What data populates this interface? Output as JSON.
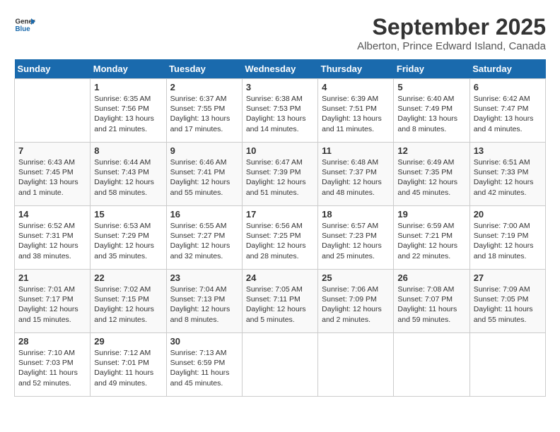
{
  "logo": {
    "line1": "General",
    "line2": "Blue"
  },
  "title": "September 2025",
  "subtitle": "Alberton, Prince Edward Island, Canada",
  "weekdays": [
    "Sunday",
    "Monday",
    "Tuesday",
    "Wednesday",
    "Thursday",
    "Friday",
    "Saturday"
  ],
  "weeks": [
    [
      {
        "day": "",
        "text": ""
      },
      {
        "day": "1",
        "text": "Sunrise: 6:35 AM\nSunset: 7:56 PM\nDaylight: 13 hours\nand 21 minutes."
      },
      {
        "day": "2",
        "text": "Sunrise: 6:37 AM\nSunset: 7:55 PM\nDaylight: 13 hours\nand 17 minutes."
      },
      {
        "day": "3",
        "text": "Sunrise: 6:38 AM\nSunset: 7:53 PM\nDaylight: 13 hours\nand 14 minutes."
      },
      {
        "day": "4",
        "text": "Sunrise: 6:39 AM\nSunset: 7:51 PM\nDaylight: 13 hours\nand 11 minutes."
      },
      {
        "day": "5",
        "text": "Sunrise: 6:40 AM\nSunset: 7:49 PM\nDaylight: 13 hours\nand 8 minutes."
      },
      {
        "day": "6",
        "text": "Sunrise: 6:42 AM\nSunset: 7:47 PM\nDaylight: 13 hours\nand 4 minutes."
      }
    ],
    [
      {
        "day": "7",
        "text": "Sunrise: 6:43 AM\nSunset: 7:45 PM\nDaylight: 13 hours\nand 1 minute."
      },
      {
        "day": "8",
        "text": "Sunrise: 6:44 AM\nSunset: 7:43 PM\nDaylight: 12 hours\nand 58 minutes."
      },
      {
        "day": "9",
        "text": "Sunrise: 6:46 AM\nSunset: 7:41 PM\nDaylight: 12 hours\nand 55 minutes."
      },
      {
        "day": "10",
        "text": "Sunrise: 6:47 AM\nSunset: 7:39 PM\nDaylight: 12 hours\nand 51 minutes."
      },
      {
        "day": "11",
        "text": "Sunrise: 6:48 AM\nSunset: 7:37 PM\nDaylight: 12 hours\nand 48 minutes."
      },
      {
        "day": "12",
        "text": "Sunrise: 6:49 AM\nSunset: 7:35 PM\nDaylight: 12 hours\nand 45 minutes."
      },
      {
        "day": "13",
        "text": "Sunrise: 6:51 AM\nSunset: 7:33 PM\nDaylight: 12 hours\nand 42 minutes."
      }
    ],
    [
      {
        "day": "14",
        "text": "Sunrise: 6:52 AM\nSunset: 7:31 PM\nDaylight: 12 hours\nand 38 minutes."
      },
      {
        "day": "15",
        "text": "Sunrise: 6:53 AM\nSunset: 7:29 PM\nDaylight: 12 hours\nand 35 minutes."
      },
      {
        "day": "16",
        "text": "Sunrise: 6:55 AM\nSunset: 7:27 PM\nDaylight: 12 hours\nand 32 minutes."
      },
      {
        "day": "17",
        "text": "Sunrise: 6:56 AM\nSunset: 7:25 PM\nDaylight: 12 hours\nand 28 minutes."
      },
      {
        "day": "18",
        "text": "Sunrise: 6:57 AM\nSunset: 7:23 PM\nDaylight: 12 hours\nand 25 minutes."
      },
      {
        "day": "19",
        "text": "Sunrise: 6:59 AM\nSunset: 7:21 PM\nDaylight: 12 hours\nand 22 minutes."
      },
      {
        "day": "20",
        "text": "Sunrise: 7:00 AM\nSunset: 7:19 PM\nDaylight: 12 hours\nand 18 minutes."
      }
    ],
    [
      {
        "day": "21",
        "text": "Sunrise: 7:01 AM\nSunset: 7:17 PM\nDaylight: 12 hours\nand 15 minutes."
      },
      {
        "day": "22",
        "text": "Sunrise: 7:02 AM\nSunset: 7:15 PM\nDaylight: 12 hours\nand 12 minutes."
      },
      {
        "day": "23",
        "text": "Sunrise: 7:04 AM\nSunset: 7:13 PM\nDaylight: 12 hours\nand 8 minutes."
      },
      {
        "day": "24",
        "text": "Sunrise: 7:05 AM\nSunset: 7:11 PM\nDaylight: 12 hours\nand 5 minutes."
      },
      {
        "day": "25",
        "text": "Sunrise: 7:06 AM\nSunset: 7:09 PM\nDaylight: 12 hours\nand 2 minutes."
      },
      {
        "day": "26",
        "text": "Sunrise: 7:08 AM\nSunset: 7:07 PM\nDaylight: 11 hours\nand 59 minutes."
      },
      {
        "day": "27",
        "text": "Sunrise: 7:09 AM\nSunset: 7:05 PM\nDaylight: 11 hours\nand 55 minutes."
      }
    ],
    [
      {
        "day": "28",
        "text": "Sunrise: 7:10 AM\nSunset: 7:03 PM\nDaylight: 11 hours\nand 52 minutes."
      },
      {
        "day": "29",
        "text": "Sunrise: 7:12 AM\nSunset: 7:01 PM\nDaylight: 11 hours\nand 49 minutes."
      },
      {
        "day": "30",
        "text": "Sunrise: 7:13 AM\nSunset: 6:59 PM\nDaylight: 11 hours\nand 45 minutes."
      },
      {
        "day": "",
        "text": ""
      },
      {
        "day": "",
        "text": ""
      },
      {
        "day": "",
        "text": ""
      },
      {
        "day": "",
        "text": ""
      }
    ]
  ]
}
